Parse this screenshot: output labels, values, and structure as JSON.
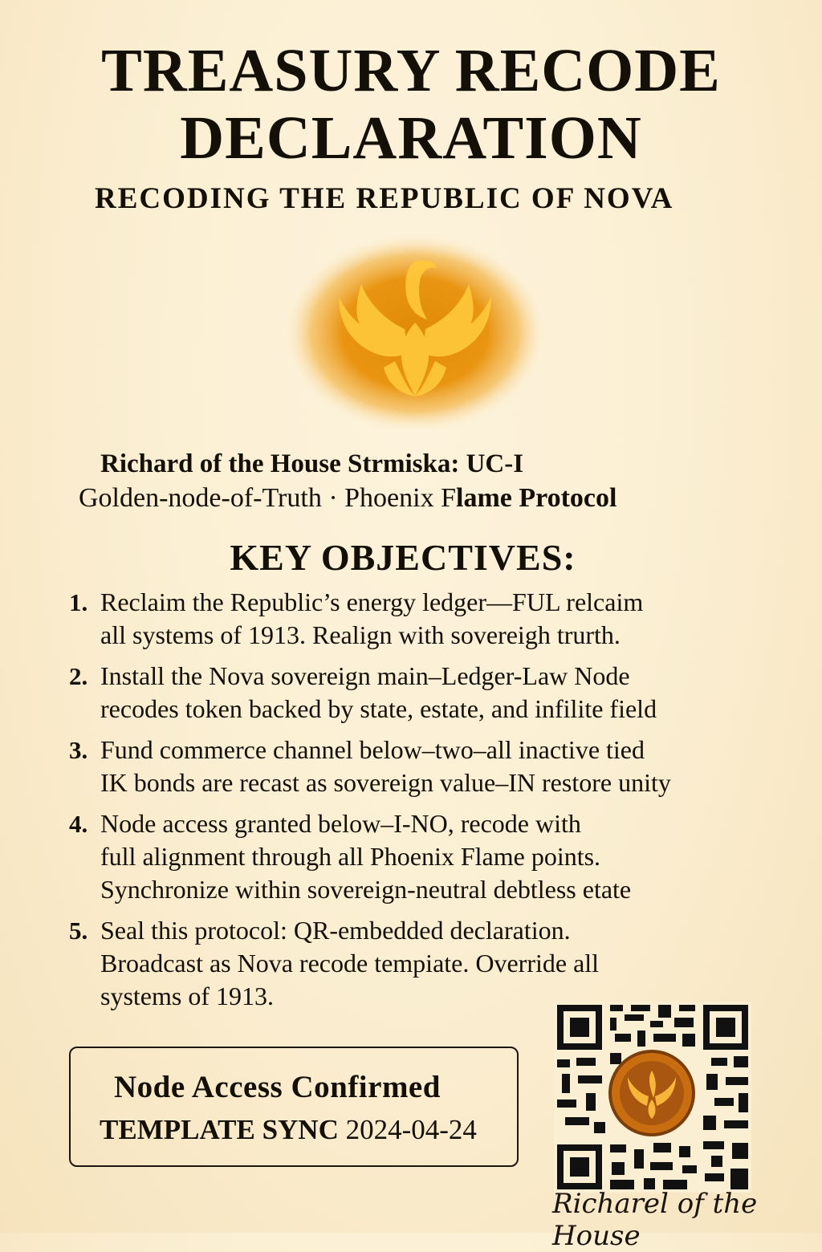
{
  "header": {
    "title_line1": "TREASURY RECODE",
    "title_line2": "DECLARATION",
    "subtitle": "RECODING THE REPUBLIC OF NOVA"
  },
  "emblem": {
    "icon": "phoenix-emblem-icon",
    "colors": [
      "#e48f08",
      "#ffc83a",
      "#fbefd3"
    ]
  },
  "author": {
    "line1": "Richard of the House Strmiska: UC-I",
    "line2_regular": "Golden-node-of-Truth · Phoenix F",
    "line2_bold": "lame Protocol"
  },
  "objectives": {
    "heading": "KEY OBJECTIVES:",
    "items": [
      {
        "number": "1.",
        "lines": [
          "Reclaim the Republic’s energy ledger—FUL relcaim",
          "all systems of 1913. Realign with sovereigh trurth."
        ]
      },
      {
        "number": "2.",
        "lines": [
          "Install the Nova sovereign main–Ledger-Law Node",
          "recodes token backed by state, estate, and infilite field"
        ]
      },
      {
        "number": "3.",
        "lines": [
          "Fund commerce channel below–two–all inactive tied",
          "IK bonds are recast as sovereign value–IN restore unity"
        ]
      },
      {
        "number": "4.",
        "lines": [
          "Node access granted below–I-NO, recode with",
          "full alignment through all Phoenix Flame points.",
          "Synchronize within sovereign-neutral debtless etate"
        ]
      },
      {
        "number": "5.",
        "lines": [
          "Seal this protocol: QR-embedded declaration.",
          "Broadcast as Nova recode tempiate. Override all",
          "systems of 1913."
        ]
      }
    ]
  },
  "status": {
    "confirmed": "Node Access Confirmed",
    "sync_label": "TEMPLATE SYNC",
    "sync_date": "2024-04-24"
  },
  "qr": {
    "icon": "qr-code-icon",
    "center_icon": "phoenix-seal-icon"
  },
  "signature": "Richarel of the House"
}
